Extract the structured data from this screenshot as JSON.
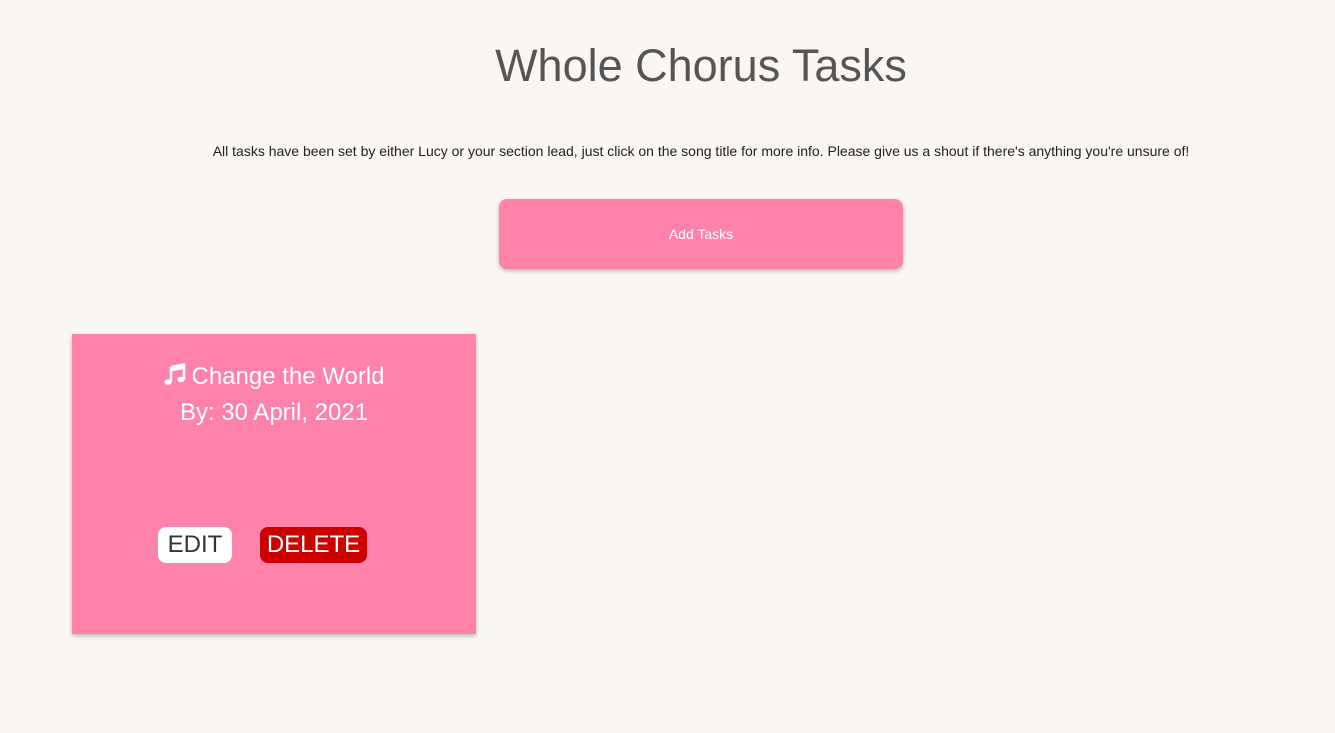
{
  "page": {
    "title": "Whole Chorus Tasks",
    "intro": "All tasks have been set by either Lucy or your section lead, just click on the song title for more info. Please give us a shout if there's anything you're unsure of!",
    "add_tasks_label": "Add Tasks"
  },
  "tasks": [
    {
      "icon": "music-note-icon",
      "title": "Change the World",
      "due": "By: 30 April, 2021",
      "edit_label": "EDIT",
      "delete_label": "DELETE"
    }
  ],
  "colors": {
    "background": "#faf6f3",
    "accent_pink": "#ff82aa",
    "delete_red": "#cc0000",
    "title_gray": "#555555"
  }
}
